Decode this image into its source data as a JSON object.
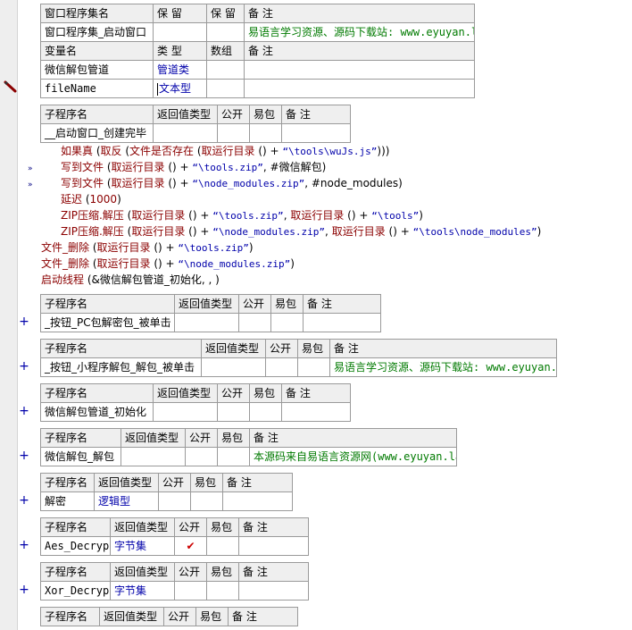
{
  "assembly_table": {
    "header": [
      "窗口程序集名",
      "保 留",
      "保 留",
      "备 注"
    ],
    "row": {
      "name": "窗口程序集_启动窗口",
      "note": "易语言学习资源、源码下载站: www.eyuyan.la"
    }
  },
  "vars_table": {
    "header": [
      "变量名",
      "类 型",
      "数组",
      "备 注"
    ],
    "rows": [
      {
        "name": "微信解包管道",
        "type": "管道类"
      },
      {
        "name": "fileName",
        "type": "文本型"
      }
    ]
  },
  "sub_header": {
    "name": "子程序名",
    "ret": "返回值类型",
    "public": "公开",
    "easy": "易包",
    "note": "备 注"
  },
  "sub1": {
    "name": "__启动窗口_创建完毕"
  },
  "code": [
    {
      "indent": 1,
      "parts": [
        [
          "kw",
          "如果真"
        ],
        [
          "op",
          " ("
        ],
        [
          "fn",
          "取反"
        ],
        [
          "op",
          " ("
        ],
        [
          "fn",
          "文件是否存在"
        ],
        [
          "op",
          " ("
        ],
        [
          "fn",
          "取运行目录"
        ],
        [
          "op",
          " () + "
        ],
        [
          "str",
          "“\\tools\\wuJs.js”"
        ],
        [
          "op",
          ")))"
        ]
      ]
    },
    {
      "indent": 1,
      "parts": [
        [
          "fn",
          "写到文件"
        ],
        [
          "op",
          " ("
        ],
        [
          "fn",
          "取运行目录"
        ],
        [
          "op",
          " () + "
        ],
        [
          "str",
          "“\\tools.zip”"
        ],
        [
          "op",
          ", #微信解包)"
        ]
      ]
    },
    {
      "indent": 1,
      "parts": [
        [
          "fn",
          "写到文件"
        ],
        [
          "op",
          " ("
        ],
        [
          "fn",
          "取运行目录"
        ],
        [
          "op",
          " () + "
        ],
        [
          "str",
          "“\\node_modules.zip”"
        ],
        [
          "op",
          ", #node_modules)"
        ]
      ]
    },
    {
      "indent": 1,
      "parts": [
        [
          "fn",
          "延迟"
        ],
        [
          "op",
          " ("
        ],
        [
          "num",
          "1000"
        ],
        [
          "op",
          ")"
        ]
      ]
    },
    {
      "indent": 1,
      "parts": [
        [
          "fn",
          "ZIP压缩.解压"
        ],
        [
          "op",
          " ("
        ],
        [
          "fn",
          "取运行目录"
        ],
        [
          "op",
          " () + "
        ],
        [
          "str",
          "“\\tools.zip”"
        ],
        [
          "op",
          ", "
        ],
        [
          "fn",
          "取运行目录"
        ],
        [
          "op",
          " () + "
        ],
        [
          "str",
          "“\\tools”"
        ],
        [
          "op",
          ")"
        ]
      ]
    },
    {
      "indent": 1,
      "parts": [
        [
          "fn",
          "ZIP压缩.解压"
        ],
        [
          "op",
          " ("
        ],
        [
          "fn",
          "取运行目录"
        ],
        [
          "op",
          " () + "
        ],
        [
          "str",
          "“\\node_modules.zip”"
        ],
        [
          "op",
          ", "
        ],
        [
          "fn",
          "取运行目录"
        ],
        [
          "op",
          " () + "
        ],
        [
          "str",
          "“\\tools\\node_modules”"
        ],
        [
          "op",
          ")"
        ]
      ]
    },
    {
      "indent": 0,
      "parts": [
        [
          "fn",
          "文件_删除"
        ],
        [
          "op",
          " ("
        ],
        [
          "fn",
          "取运行目录"
        ],
        [
          "op",
          " () + "
        ],
        [
          "str",
          "“\\tools.zip”"
        ],
        [
          "op",
          ")"
        ]
      ]
    },
    {
      "indent": 0,
      "parts": [
        [
          "fn",
          "文件_删除"
        ],
        [
          "op",
          " ("
        ],
        [
          "fn",
          "取运行目录"
        ],
        [
          "op",
          " () + "
        ],
        [
          "str",
          "“\\node_modules.zip”"
        ],
        [
          "op",
          ")"
        ]
      ]
    },
    {
      "indent": 0,
      "parts": [
        [
          "fn",
          "启动线程"
        ],
        [
          "op",
          " (&微信解包管道_初始化, , )"
        ]
      ]
    }
  ],
  "subs": [
    {
      "name": "_按钮_PC包解密包_被单击",
      "ret": "",
      "checked": false,
      "note": ""
    },
    {
      "name": "_按钮_小程序解包_解包_被单击",
      "ret": "",
      "checked": false,
      "note": "易语言学习资源、源码下载站: www.eyuyan.la"
    },
    {
      "name": "微信解包管道_初始化",
      "ret": "",
      "checked": false,
      "note": ""
    },
    {
      "name": "微信解包_解包",
      "ret": "",
      "checked": false,
      "note": "本源码来自易语言资源网(www.eyuyan.la)"
    },
    {
      "name": "解密",
      "ret": "逻辑型",
      "checked": false,
      "note": ""
    },
    {
      "name": "Aes_Decrypt",
      "ret": "字节集",
      "checked": true,
      "note": ""
    },
    {
      "name": "Xor_Decrypt",
      "ret": "字节集",
      "checked": false,
      "note": ""
    },
    {
      "name": "",
      "ret": "",
      "checked": false,
      "note": ""
    }
  ],
  "icons": {
    "plus": "+",
    "expand_arrow": "»",
    "check": "✔"
  },
  "colors": {
    "keyword": "#8b0000",
    "string": "#0000aa",
    "type": "#0000aa",
    "note": "#007a00",
    "header_bg": "#efefef",
    "gutter": "#eeeeee"
  }
}
